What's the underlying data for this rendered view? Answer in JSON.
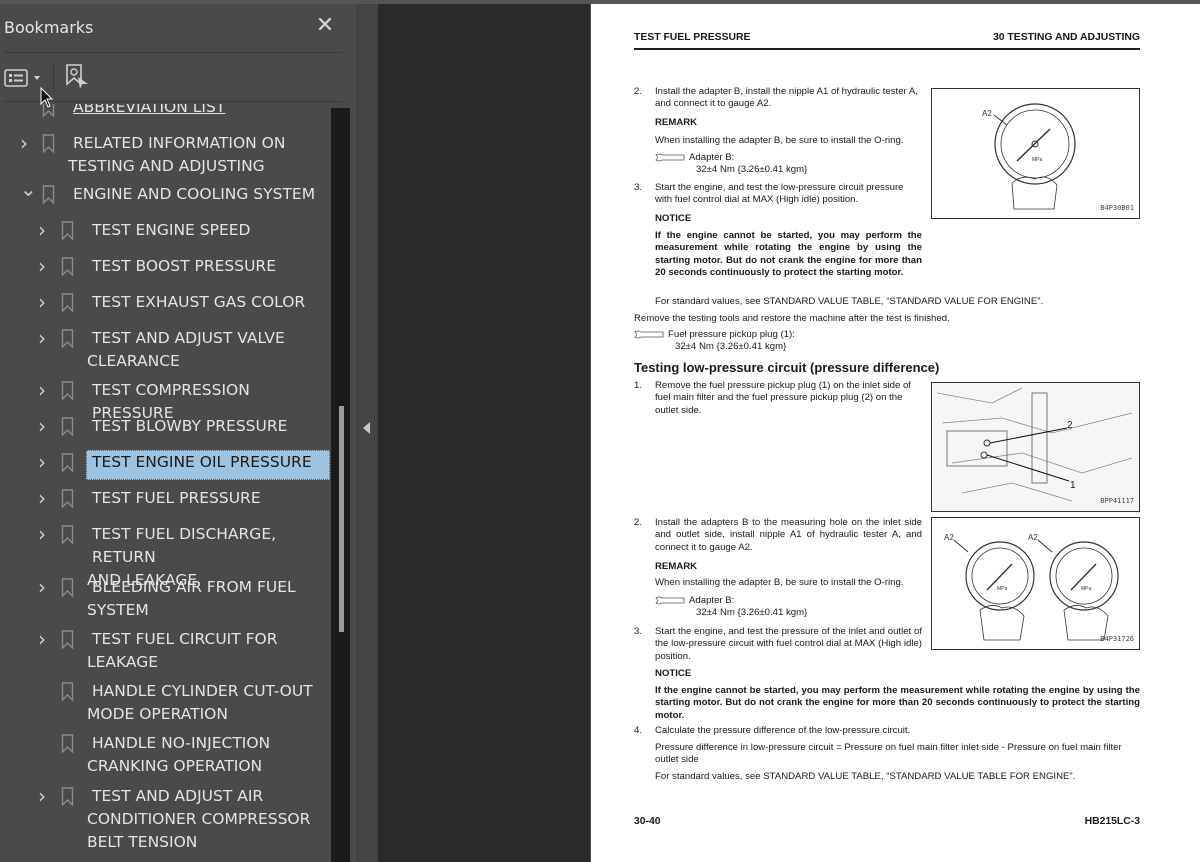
{
  "sidebar": {
    "title": "Bookmarks",
    "close_icon": "close-icon",
    "tools": {
      "options_icon": "list-options-icon",
      "find_icon": "find-current-bookmark-icon"
    },
    "items": [
      {
        "label_lines": [
          "ABBREVIATION LIST"
        ],
        "level": 1,
        "expandable": false,
        "state": "partial"
      },
      {
        "label_lines": [
          "RELATED INFORMATION ON",
          "TESTING AND ADJUSTING"
        ],
        "level": 1,
        "expandable": true,
        "expanded": false
      },
      {
        "label_lines": [
          "ENGINE AND COOLING SYSTEM"
        ],
        "level": 1,
        "expandable": true,
        "expanded": true
      },
      {
        "label_lines": [
          "TEST ENGINE SPEED"
        ],
        "level": 2,
        "expandable": true
      },
      {
        "label_lines": [
          "TEST BOOST PRESSURE"
        ],
        "level": 2,
        "expandable": true
      },
      {
        "label_lines": [
          "TEST EXHAUST GAS COLOR"
        ],
        "level": 2,
        "expandable": true
      },
      {
        "label_lines": [
          "TEST AND ADJUST VALVE",
          "CLEARANCE"
        ],
        "level": 2,
        "expandable": true
      },
      {
        "label_lines": [
          "TEST COMPRESSION PRESSURE"
        ],
        "level": 2,
        "expandable": true
      },
      {
        "label_lines": [
          "TEST BLOWBY PRESSURE"
        ],
        "level": 2,
        "expandable": true
      },
      {
        "label_lines": [
          "TEST ENGINE OIL PRESSURE"
        ],
        "level": 2,
        "expandable": true,
        "selected": true
      },
      {
        "label_lines": [
          "TEST FUEL PRESSURE"
        ],
        "level": 2,
        "expandable": true
      },
      {
        "label_lines": [
          "TEST FUEL DISCHARGE, RETURN",
          "AND LEAKAGE"
        ],
        "level": 2,
        "expandable": true
      },
      {
        "label_lines": [
          "BLEEDING AIR FROM FUEL",
          "SYSTEM"
        ],
        "level": 2,
        "expandable": true
      },
      {
        "label_lines": [
          "TEST FUEL CIRCUIT FOR",
          "LEAKAGE"
        ],
        "level": 2,
        "expandable": true
      },
      {
        "label_lines": [
          "HANDLE CYLINDER CUT-OUT",
          "MODE OPERATION"
        ],
        "level": 2,
        "expandable": false
      },
      {
        "label_lines": [
          "HANDLE NO-INJECTION",
          "CRANKING OPERATION"
        ],
        "level": 2,
        "expandable": false
      },
      {
        "label_lines": [
          "TEST AND ADJUST AIR",
          "CONDITIONER COMPRESSOR",
          "BELT TENSION"
        ],
        "level": 2,
        "expandable": true
      }
    ]
  },
  "divider": {
    "collapse_icon": "collapse-panel-left-icon"
  },
  "page": {
    "header_left": "TEST FUEL PRESSURE",
    "header_right": "30 TESTING AND ADJUSTING",
    "step2a": {
      "num": "2.",
      "text": "Install the adapter B, install the nipple A1 of hydraulic tester A, and connect it to gauge A2."
    },
    "remark1_title": "REMARK",
    "remark1_text": "When installing the adapter B, be sure to install the O-ring.",
    "torque1_label": "Adapter B:",
    "torque1_value": "32±4 Nm {3.26±0.41 kgm}",
    "step3a": {
      "num": "3.",
      "text": "Start the engine, and test the low-pressure circuit pressure with fuel control dial at MAX (High idle) position."
    },
    "notice1_title": "NOTICE",
    "notice1_text": "If the engine cannot be started, you may perform the measurement while rotating the engine by using the starting motor. But do not crank the engine for more than 20 seconds continuously to protect the starting motor.",
    "std1": "For standard values, see STANDARD VALUE TABLE, “STANDARD VALUE FOR ENGINE”.",
    "remove_text": "Remove the testing tools and restore the machine after the test is finished.",
    "torque2_label": "Fuel pressure pickup plug (1):",
    "torque2_value": "32±4 Nm {3.26±0.41 kgm}",
    "section_title": "Testing low-pressure circuit (pressure difference)",
    "step1b": {
      "num": "1.",
      "text": "Remove the fuel pressure pickup plug (1) on the inlet side of fuel main filter and the fuel pressure pickup plug (2) on the outlet side."
    },
    "step2b": {
      "num": "2.",
      "text": "Install the adapters B to the measuring hole on the inlet side and outlet side, install nipple A1 of hydraulic tester A, and connect it to gauge A2."
    },
    "remark2_title": "REMARK",
    "remark2_text": "When installing the adapter B, be sure to install the O-ring.",
    "torque3_label": "Adapter B:",
    "torque3_value": "32±4 Nm {3.26±0.41 kgm}",
    "step3b": {
      "num": "3.",
      "text": "Start the engine, and test the pressure of the inlet and outlet of the low-pressure circuit with fuel control dial at MAX (High idle) position."
    },
    "notice2_title": "NOTICE",
    "notice2_text": "If the engine cannot be started, you may perform the measurement while rotating the engine by using the starting motor. But do not crank the engine for more than 20 seconds continuously to protect the starting motor.",
    "step4b": {
      "num": "4.",
      "text": "Calculate the pressure difference of the low-pressure circuit."
    },
    "formula": "Pressure difference in low-pressure circuit = Pressure on fuel main filter inlet side - Pressure on fuel main filter outlet side",
    "std2": "For standard values, see STANDARD VALUE TABLE, “STANDARD VALUE TABLE FOR ENGINE”.",
    "figures": [
      {
        "labels": [
          "A2"
        ],
        "code": "B4P30B01",
        "unit": "MPa"
      },
      {
        "labels": [
          "2",
          "1"
        ],
        "code": "BPP41117"
      },
      {
        "labels": [
          "A2",
          "A2"
        ],
        "code": "B4P31726",
        "unit": "MPa"
      }
    ],
    "footer_left": "30-40",
    "footer_right": "HB215LC-3"
  }
}
